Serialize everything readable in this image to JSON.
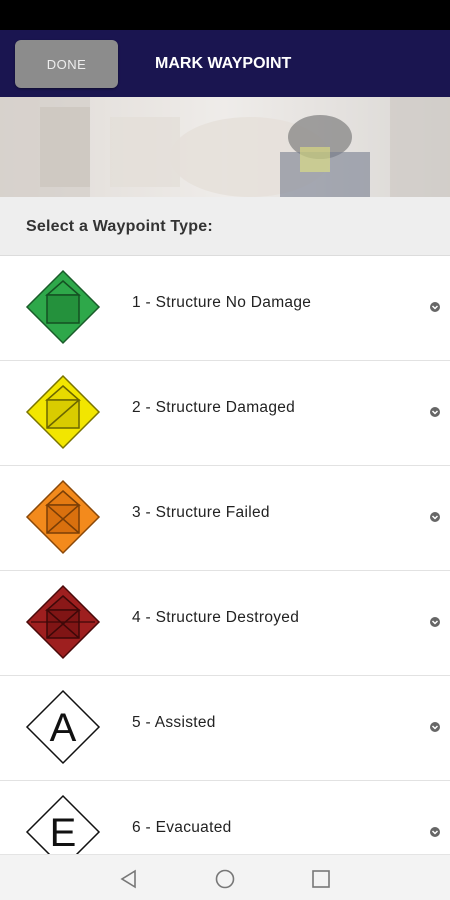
{
  "app_bar": {
    "done_label": "DONE",
    "title": "MARK WAYPOINT",
    "background": "#1a1550"
  },
  "section": {
    "header": "Select a Waypoint Type:"
  },
  "waypoints": [
    {
      "label": "1 - Structure No Damage",
      "icon": "structure-no-damage-icon",
      "color": "#2ea84a"
    },
    {
      "label": "2 - Structure Damaged",
      "icon": "structure-damaged-icon",
      "color": "#f2e600"
    },
    {
      "label": "3 - Structure Failed",
      "icon": "structure-failed-icon",
      "color": "#f38a1c"
    },
    {
      "label": "4 - Structure Destroyed",
      "icon": "structure-destroyed-icon",
      "color": "#9e1f1f"
    },
    {
      "label": "5 - Assisted",
      "icon": "assisted-icon",
      "letter": "A",
      "color": "#ffffff"
    },
    {
      "label": "6 - Evacuated",
      "icon": "evacuated-icon",
      "letter": "E",
      "color": "#ffffff"
    }
  ],
  "nav": {
    "back": "back-triangle-icon",
    "home": "home-circle-icon",
    "recents": "recents-square-icon"
  }
}
